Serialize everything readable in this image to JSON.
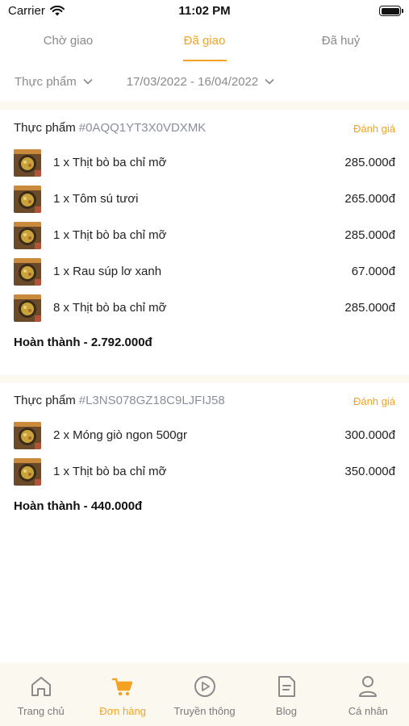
{
  "status_bar": {
    "carrier": "Carrier",
    "time": "11:02 PM"
  },
  "tabs": [
    {
      "label": "Chờ giao",
      "active": false
    },
    {
      "label": "Đã giao",
      "active": true
    },
    {
      "label": "Đã huỷ",
      "active": false
    }
  ],
  "filters": {
    "category": "Thực phẩm",
    "date_range": "17/03/2022 - 16/04/2022"
  },
  "orders": [
    {
      "category": "Thực phẩm",
      "code": "#0AQQ1YT3X0VDXMK",
      "rate_label": "Đánh giá",
      "items": [
        {
          "name": "1 x Thịt bò ba chỉ mỡ",
          "price": "285.000đ"
        },
        {
          "name": "1 x Tôm sú tươi",
          "price": "265.000đ"
        },
        {
          "name": "1 x Thịt bò ba chỉ mỡ",
          "price": "285.000đ"
        },
        {
          "name": "1 x Rau súp lơ xanh",
          "price": "67.000đ"
        },
        {
          "name": "8 x Thịt bò ba chỉ mỡ",
          "price": "285.000đ"
        }
      ],
      "total": "Hoàn thành - 2.792.000đ"
    },
    {
      "category": "Thực phẩm",
      "code": "#L3NS078GZ18C9LJFIJ58",
      "rate_label": "Đánh giá",
      "items": [
        {
          "name": "2 x Móng giò ngon 500gr",
          "price": "300.000đ"
        },
        {
          "name": "1 x Thịt bò ba chỉ mỡ",
          "price": "350.000đ"
        }
      ],
      "total": "Hoàn thành - 440.000đ"
    }
  ],
  "bottom_nav": [
    {
      "label": "Trang chủ",
      "icon": "home-icon",
      "active": false
    },
    {
      "label": "Đơn hàng",
      "icon": "cart-icon",
      "active": true
    },
    {
      "label": "Truyền thông",
      "icon": "play-icon",
      "active": false
    },
    {
      "label": "Blog",
      "icon": "document-icon",
      "active": false
    },
    {
      "label": "Cá nhân",
      "icon": "person-icon",
      "active": false
    }
  ],
  "colors": {
    "accent": "#f4a223",
    "muted": "#8a8a8a",
    "band": "#fbf8ef"
  }
}
